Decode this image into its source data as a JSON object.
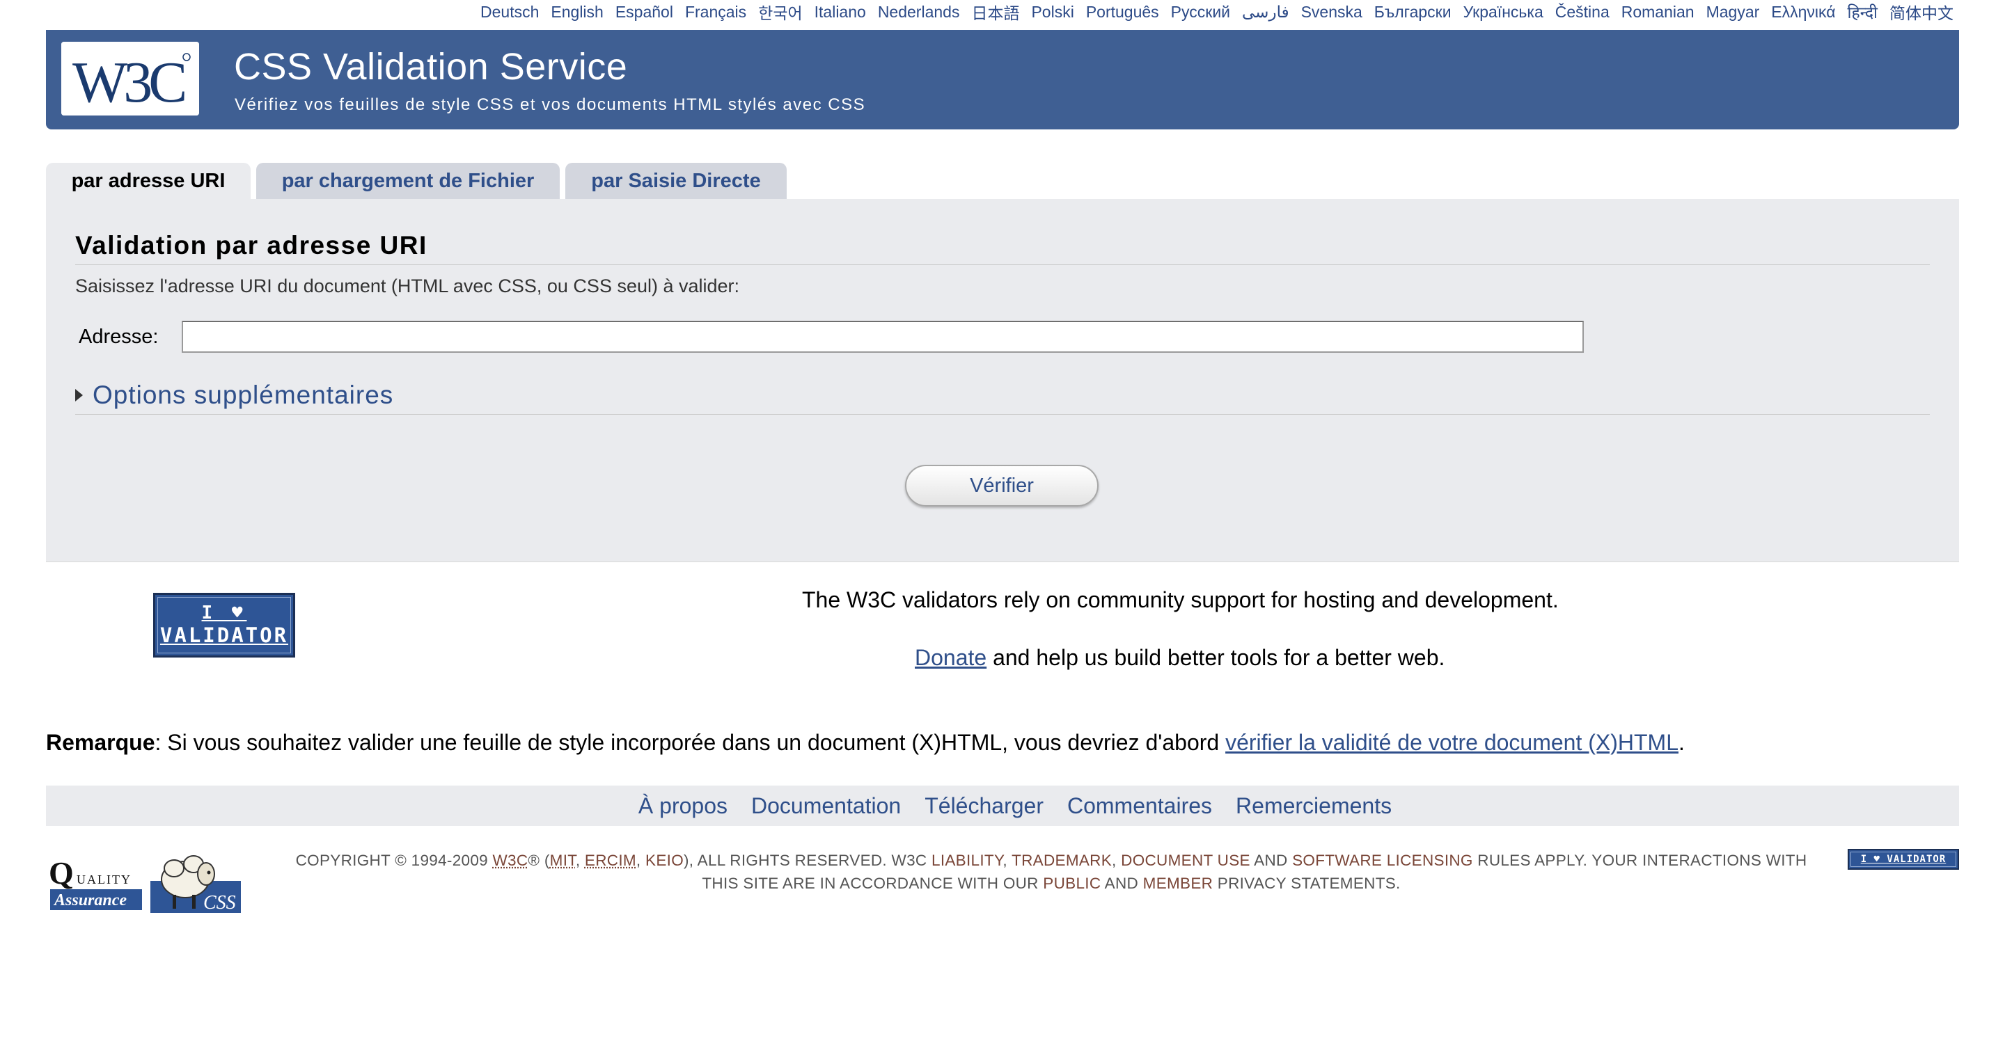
{
  "languages": [
    "Deutsch",
    "English",
    "Español",
    "Français",
    "한국어",
    "Italiano",
    "Nederlands",
    "日本語",
    "Polski",
    "Português",
    "Русский",
    "فارسی",
    "Svenska",
    "Български",
    "Українська",
    "Čeština",
    "Romanian",
    "Magyar",
    "Ελληνικά",
    "हिन्दी",
    "简体中文"
  ],
  "header": {
    "logo_text": "W3C",
    "title": "CSS Validation Service",
    "subtitle": "Vérifiez vos feuilles de style CSS et vos documents HTML stylés avec CSS"
  },
  "tabs": [
    {
      "label": "par adresse URI",
      "active": true
    },
    {
      "label": "par chargement de Fichier",
      "active": false
    },
    {
      "label": "par Saisie Directe",
      "active": false
    }
  ],
  "form": {
    "section_title": "Validation par adresse URI",
    "instruction": "Saisissez l'adresse URI du document (HTML avec CSS, ou CSS seul) à valider:",
    "address_label": "Adresse:",
    "address_value": "",
    "options_label": "Options supplémentaires",
    "submit_label": "Vérifier"
  },
  "support": {
    "badge_line1": "I ♥",
    "badge_line2": "VALIDATOR",
    "text": "The W3C validators rely on community support for hosting and development.",
    "donate_link": "Donate",
    "donate_rest": " and help us build better tools for a better web."
  },
  "note": {
    "label": "Remarque",
    "text": ": Si vous souhaitez valider une feuille de style incorporée dans un document (X)HTML, vous devriez d'abord ",
    "link": "vérifier la validité de votre document (X)HTML",
    "end": "."
  },
  "footer_nav": [
    "À propos",
    "Documentation",
    "Télécharger",
    "Commentaires",
    "Remerciements"
  ],
  "copyright": {
    "p1": "COPYRIGHT © 1994-2009 ",
    "w3c": "W3C",
    "p2": "® (",
    "mit": "MIT",
    "sep1": ", ",
    "ercim": "ERCIM",
    "sep2": ", ",
    "keio": "KEIO",
    "p3": "), ALL RIGHTS RESERVED. W3C ",
    "liability": "LIABILITY",
    "sep3": ", ",
    "trademark": "TRADEMARK",
    "sep4": ", ",
    "document_use": "DOCUMENT USE",
    "p4": " AND ",
    "software_licensing": "SOFTWARE LICENSING",
    "p5": " RULES APPLY. YOUR INTERACTIONS WITH THIS SITE ARE IN ACCORDANCE WITH OUR ",
    "public": "PUBLIC",
    "p6": " AND ",
    "member": "MEMBER",
    "p7": " PRIVACY STATEMENTS."
  },
  "logos": {
    "qa_text1": "Q",
    "qa_text2": "UALITY",
    "qa_text3": "Assurance",
    "css_text": "CSS",
    "mini_badge": "I ♥ VALIDATOR"
  },
  "colors": {
    "banner": "#3f5f93",
    "link": "#2f4f8a",
    "panel": "#eaebee",
    "inactive_tab": "#d3d6de",
    "copyright_link": "#7a4638"
  }
}
